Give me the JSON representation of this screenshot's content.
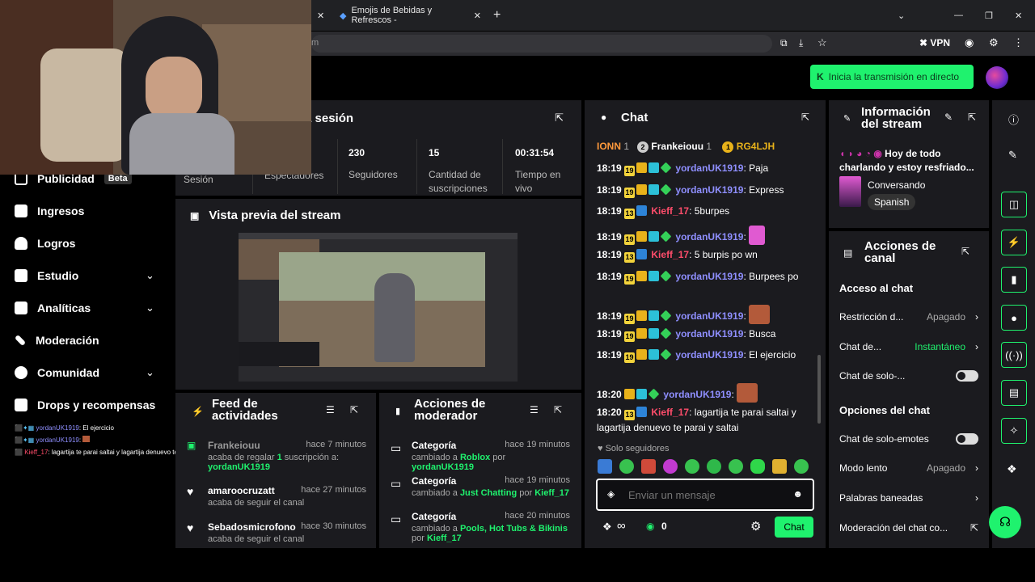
{
  "browser": {
    "tabs": [
      {
        "label": "",
        "close": "✕"
      },
      {
        "label": "Emojis de Bebidas y Refrescos -",
        "close": "✕"
      }
    ],
    "new_tab": "+",
    "url_fragment": "m",
    "vpn_label": "VPN"
  },
  "header": {
    "go_live": "Inicia la transmisión en directo"
  },
  "session": {
    "title": "a sesión",
    "stats": [
      {
        "value": "",
        "label": "Sesión"
      },
      {
        "value": "",
        "label": "Espectadores"
      },
      {
        "value": "230",
        "label": "Seguidores"
      },
      {
        "value": "15",
        "label": "Cantidad de suscripciones"
      },
      {
        "value": "00:31:54",
        "label": "Tiempo en vivo"
      }
    ]
  },
  "sidebar": {
    "items": [
      {
        "label": "Publicidad",
        "badge": "Beta"
      },
      {
        "label": "Ingresos"
      },
      {
        "label": "Logros"
      },
      {
        "label": "Estudio"
      },
      {
        "label": "Analíticas"
      },
      {
        "label": "Moderación"
      },
      {
        "label": "Comunidad"
      },
      {
        "label": "Drops y recompensas"
      }
    ],
    "mini_chat": [
      {
        "user": "yordanUK1919",
        "text": ": El ejercicio"
      },
      {
        "user": "yordanUK1919",
        "text": ":"
      },
      {
        "user": "Kieff_17",
        "text": ": lagartija te parai saltai y lagartija denuevo te parai y saltai"
      }
    ]
  },
  "preview": {
    "title": "Vista previa del stream"
  },
  "feed": {
    "title": "Feed de actividades",
    "rows": [
      {
        "user": "Frankeiouu",
        "time": "hace 7 minutos",
        "sub_pre": "acaba de regalar ",
        "sub_count": "1",
        "sub_post": " suscripción a:",
        "target": "yordanUK1919"
      },
      {
        "user": "amaroocruzatt",
        "time": "hace 27 minutos",
        "sub": "acaba de seguir el canal"
      },
      {
        "user": "Sebadosmicrofono",
        "time": "hace 30 minutos",
        "sub": "acaba de seguir el canal"
      }
    ]
  },
  "mod_actions": {
    "title": "Acciones de moderador",
    "rows": [
      {
        "title": "Categoría",
        "time": "hace 19 minutos",
        "pre": "cambiado a ",
        "cat": "Roblox",
        "by": " por ",
        "user": "yordanUK1919"
      },
      {
        "title": "Categoría",
        "time": "hace 19 minutos",
        "pre": "cambiado a ",
        "cat": "Just Chatting",
        "by": " por ",
        "user": "Kieff_17"
      },
      {
        "title": "Categoría",
        "time": "hace 20 minutos",
        "pre": "cambiado a ",
        "cat": "Pools, Hot Tubs & Bikinis",
        "by": "por ",
        "user": "Kieff_17"
      }
    ]
  },
  "chat": {
    "title": "Chat",
    "gifters": [
      {
        "name": "IONN",
        "count": "1"
      },
      {
        "name": "Frankeiouu",
        "count": "1",
        "rank": "2"
      },
      {
        "name": "RG4LJH",
        "rank": "1"
      }
    ],
    "messages": [
      {
        "time": "18:19",
        "sub": "19",
        "user": "yordanUK1919",
        "text": ": Paja"
      },
      {
        "time": "18:19",
        "sub": "19",
        "user": "yordanUK1919",
        "text": ": Express"
      },
      {
        "time": "18:19",
        "sub": "13",
        "user": "Kieff_17",
        "text": ": 5burpes"
      },
      {
        "time": "18:19",
        "sub": "19",
        "user": "yordanUK1919",
        "text": ":"
      },
      {
        "time": "18:19",
        "sub": "13",
        "user": "Kieff_17",
        "text": ": 5 burpis po wn"
      },
      {
        "time": "18:19",
        "sub": "19",
        "user": "yordanUK1919",
        "text": ": Burpees po"
      },
      {
        "time": "18:19",
        "sub": "19",
        "user": "yordanUK1919",
        "text": ":"
      },
      {
        "time": "18:19",
        "sub": "19",
        "user": "yordanUK1919",
        "text": ": Busca"
      },
      {
        "time": "18:19",
        "sub": "19",
        "user": "yordanUK1919",
        "text": ": El ejercicio"
      },
      {
        "time": "18:20",
        "sub": "",
        "user": "yordanUK1919",
        "text": ":"
      },
      {
        "time": "18:20",
        "sub": "13",
        "user": "Kieff_17",
        "text": ": lagartija te parai saltai y lagartija denuevo te parai y saltai"
      }
    ],
    "followers_only": "Solo seguidores",
    "placeholder": "Enviar un mensaje",
    "points": "0",
    "send": "Chat",
    "infinity": "∞"
  },
  "stream_info": {
    "title": "Información del stream",
    "description": "Hoy de todo charlando y estoy resfriado...",
    "category": "Conversando",
    "language": "Spanish"
  },
  "channel_actions": {
    "title": "Acciones de canal",
    "section1": "Acceso al chat",
    "rows1": [
      {
        "label": "Restricción d...",
        "value": "Apagado"
      },
      {
        "label": "Chat de...",
        "value": "Instantáneo"
      },
      {
        "label": "Chat de solo-..."
      }
    ],
    "section2": "Opciones del chat",
    "rows2": [
      {
        "label": "Chat de solo-emotes"
      },
      {
        "label": "Modo lento",
        "value": "Apagado"
      },
      {
        "label": "Palabras baneadas"
      },
      {
        "label": "Moderación del chat co..."
      }
    ]
  },
  "colors": {
    "accent": "#1ff26e",
    "panel": "#1b1b1f",
    "user_blue": "#8f8fff",
    "user_red": "#ff4d6b"
  }
}
